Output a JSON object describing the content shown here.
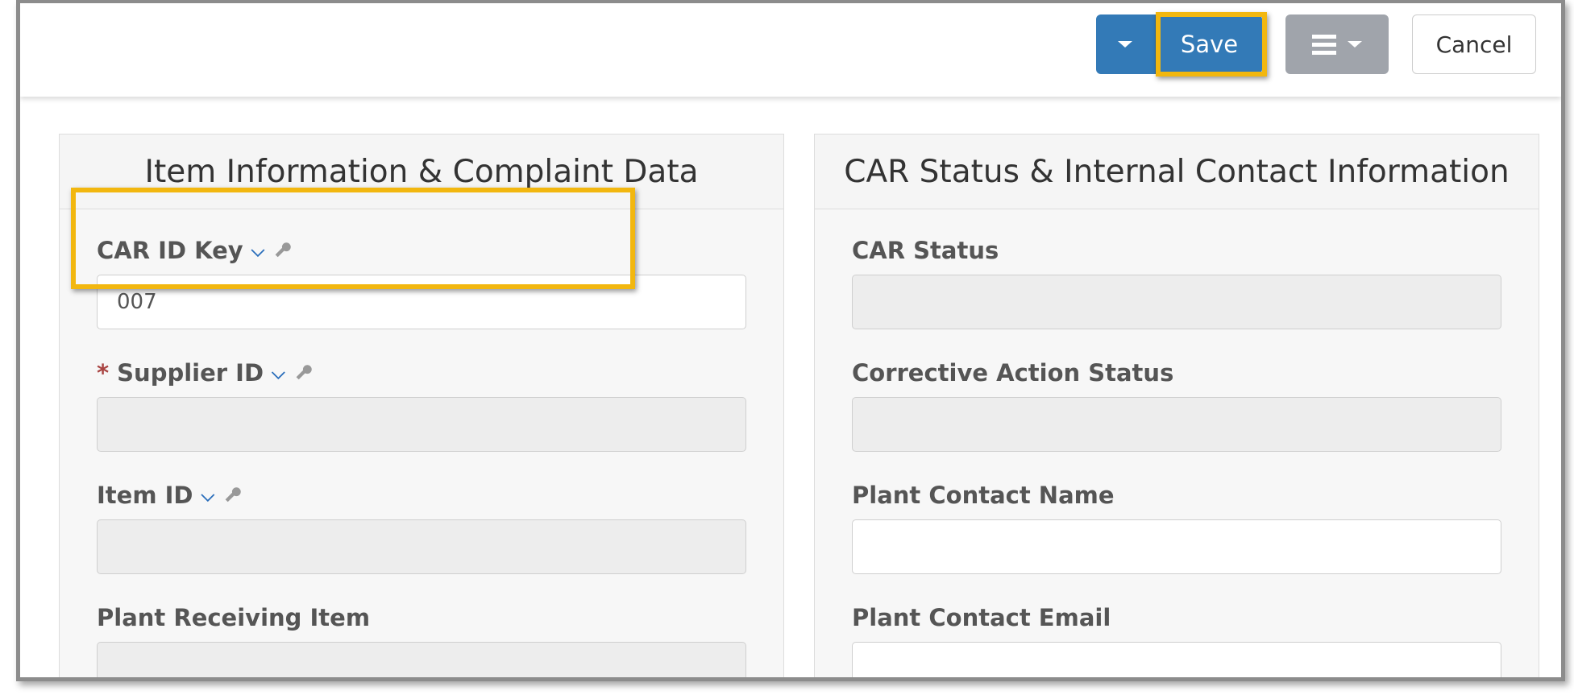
{
  "toolbar": {
    "save_label": "Save",
    "cancel_label": "Cancel"
  },
  "left_panel": {
    "title": "Item Information & Complaint Data",
    "fields": [
      {
        "label": "CAR ID Key",
        "value": "007",
        "required": false
      },
      {
        "label": "Supplier ID",
        "value": "",
        "required": true,
        "required_mark": "*"
      },
      {
        "label": "Item ID",
        "value": "",
        "required": false
      },
      {
        "label": "Plant Receiving Item",
        "value": "",
        "required": false
      }
    ]
  },
  "right_panel": {
    "title": "CAR Status & Internal Contact Information",
    "fields": [
      {
        "label": "CAR Status",
        "value": ""
      },
      {
        "label": "Corrective Action Status",
        "value": ""
      },
      {
        "label": "Plant Contact Name",
        "value": ""
      },
      {
        "label": "Plant Contact Email",
        "value": ""
      }
    ]
  },
  "colors": {
    "primary": "#337ab7",
    "highlight": "#f2b70f",
    "menu_button": "#a0a4ab",
    "required": "#a94442"
  },
  "icons": {
    "dropdown": "chevron-down-icon",
    "key": "key-icon",
    "menu": "hamburger-icon",
    "caret": "caret-down-icon"
  }
}
